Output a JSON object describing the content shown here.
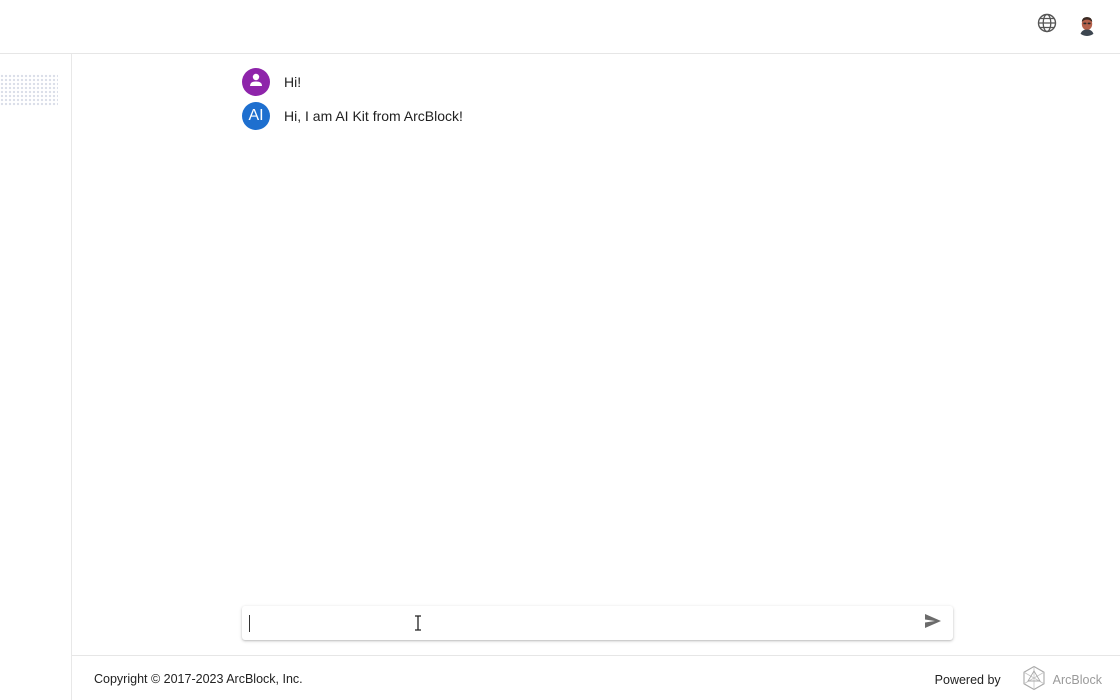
{
  "header": {
    "language_icon": "globe-icon",
    "avatar_icon": "user-avatar-photo"
  },
  "sidebar": {
    "logo": "dotted-logo-placeholder"
  },
  "messages": [
    {
      "role": "user",
      "avatar_icon": "person-icon",
      "text": "Hi!"
    },
    {
      "role": "ai",
      "avatar_label": "AI",
      "text": "Hi, I am AI Kit from ArcBlock!"
    }
  ],
  "composer": {
    "value": "",
    "placeholder": "",
    "send_icon": "send-icon"
  },
  "footer": {
    "copyright": "Copyright © 2017-2023  ArcBlock, Inc.",
    "powered_by": "Powered by",
    "brand_name": "ArcBlock",
    "brand_icon": "arcblock-logo-icon"
  },
  "colors": {
    "user_avatar": "#8e24aa",
    "ai_avatar": "#1e6fcf",
    "divider": "#e6e6e6"
  }
}
